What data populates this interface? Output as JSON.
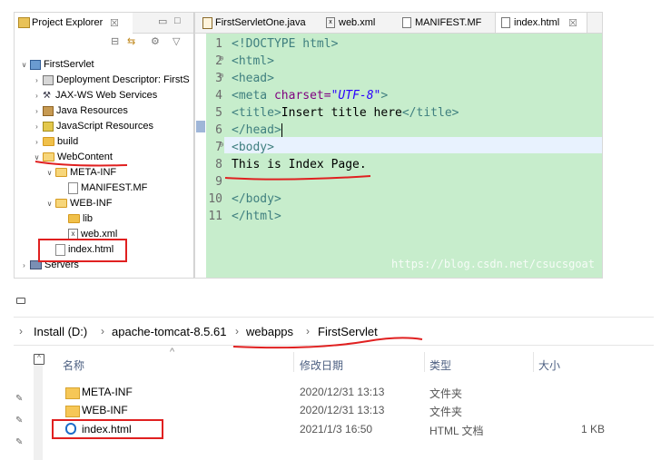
{
  "project_explorer": {
    "title": "Project Explorer",
    "close_glyph": "☒",
    "minimize_glyph": "▭",
    "maximize_glyph": "□",
    "toolbar": {
      "collapse_glyph": "⊟",
      "link_glyph": "⇆",
      "focus_glyph": "⚙",
      "menu_glyph": "▽"
    },
    "tree": [
      {
        "label": "FirstServlet",
        "twisty": "∨"
      },
      {
        "label": "Deployment Descriptor: FirstS",
        "twisty": "›"
      },
      {
        "label": "JAX-WS Web Services",
        "twisty": "›"
      },
      {
        "label": "Java Resources",
        "twisty": "›"
      },
      {
        "label": "JavaScript Resources",
        "twisty": "›"
      },
      {
        "label": "build",
        "twisty": "›"
      },
      {
        "label": "WebContent",
        "twisty": "∨"
      },
      {
        "label": "META-INF",
        "twisty": "∨"
      },
      {
        "label": "MANIFEST.MF",
        "twisty": ""
      },
      {
        "label": "WEB-INF",
        "twisty": "∨"
      },
      {
        "label": "lib",
        "twisty": ""
      },
      {
        "label": "web.xml",
        "twisty": ""
      },
      {
        "label": "index.html",
        "twisty": ""
      },
      {
        "label": "Servers",
        "twisty": "›"
      }
    ]
  },
  "editor": {
    "tabs": [
      {
        "label": "FirstServletOne.java"
      },
      {
        "label": "web.xml"
      },
      {
        "label": "MANIFEST.MF"
      },
      {
        "label": "index.html",
        "close": "☒"
      }
    ],
    "lines": [
      {
        "num": "1",
        "fold": ""
      },
      {
        "num": "2",
        "fold": "⊖"
      },
      {
        "num": "3",
        "fold": "⊖"
      },
      {
        "num": "4",
        "fold": ""
      },
      {
        "num": "5",
        "fold": ""
      },
      {
        "num": "6",
        "fold": ""
      },
      {
        "num": "7",
        "fold": "⊖"
      },
      {
        "num": "8",
        "fold": ""
      },
      {
        "num": "9",
        "fold": ""
      },
      {
        "num": "10",
        "fold": ""
      },
      {
        "num": "11",
        "fold": ""
      }
    ],
    "code": {
      "l1": "<!DOCTYPE html>",
      "l2": "<html>",
      "l3": "<head>",
      "l4_open": "<meta",
      "l4_attr": " charset=",
      "l4_val": "\"UTF-8\"",
      "l4_close": ">",
      "l5_open": "<title>",
      "l5_text": "Insert title here",
      "l5_close": "</title>",
      "l6": "</head>",
      "l7": "<body>",
      "l8": "This is Index Page.",
      "l10": "</body>",
      "l11": "</html>"
    },
    "watermark": "https://blog.csdn.net/csucsgoat"
  },
  "explorer": {
    "pin_glyph": "📌",
    "breadcrumb": [
      "Install (D:)",
      "apache-tomcat-8.5.61",
      "webapps",
      "FirstServlet"
    ],
    "breadcrumb_sep": "›",
    "columns": {
      "name": "名称",
      "modified": "修改日期",
      "type": "类型",
      "size": "大小"
    },
    "sort_glyph": "^",
    "files": [
      {
        "name": "META-INF",
        "modified": "2020/12/31 13:13",
        "type": "文件夹",
        "size": ""
      },
      {
        "name": "WEB-INF",
        "modified": "2020/12/31 13:13",
        "type": "文件夹",
        "size": ""
      },
      {
        "name": "index.html",
        "modified": "2021/1/3 16:50",
        "type": "HTML 文档",
        "size": "1 KB"
      }
    ]
  }
}
